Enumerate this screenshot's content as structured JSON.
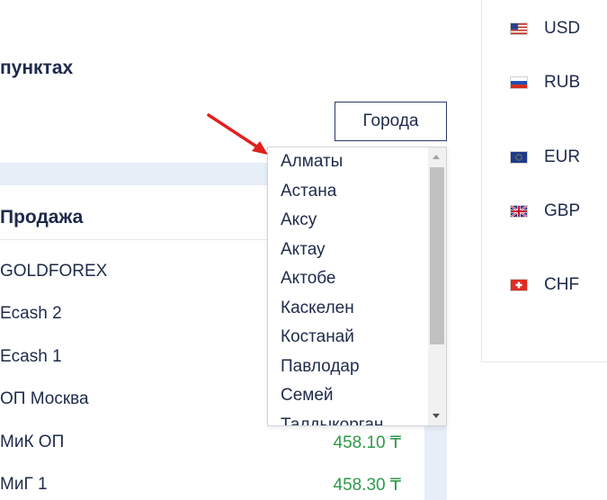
{
  "heading": "пунктах",
  "cities_button": "Города",
  "table": {
    "column_title": "Продажа",
    "rows": [
      {
        "name": "GOLDFOREX",
        "value": ""
      },
      {
        "name": "Ecash 2",
        "value": ""
      },
      {
        "name": "Ecash 1",
        "value": ""
      },
      {
        "name": "ОП Москва",
        "value": ""
      },
      {
        "name": "МиК ОП",
        "value": "458.10 ₸"
      },
      {
        "name": "МиГ 1",
        "value": "458.30 ₸"
      }
    ]
  },
  "cities_dropdown": {
    "items": [
      "Алматы",
      "Астана",
      "Аксу",
      "Актау",
      "Актобе",
      "Каскелен",
      "Костанай",
      "Павлодар",
      "Семей",
      "Талдыкорган"
    ]
  },
  "currencies": [
    {
      "code": "USD",
      "flag": "us-flag-icon"
    },
    {
      "code": "RUB",
      "flag": "ru-flag-icon"
    },
    {
      "code": "EUR",
      "flag": "eu-flag-icon"
    },
    {
      "code": "GBP",
      "flag": "gb-flag-icon"
    },
    {
      "code": "CHF",
      "flag": "ch-flag-icon"
    }
  ],
  "colors": {
    "text": "#1e2a4a",
    "value_green": "#2e9a4a",
    "table_band": "#e6eef8",
    "arrow_red": "#e0201c"
  }
}
